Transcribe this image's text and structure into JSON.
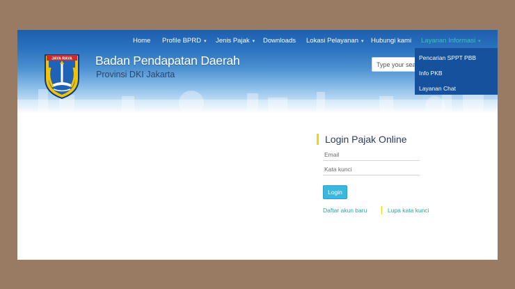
{
  "nav": {
    "items": [
      {
        "label": "Home",
        "dropdown": false
      },
      {
        "label": "Profile BPRD",
        "dropdown": true
      },
      {
        "label": "Jenis Pajak",
        "dropdown": true
      },
      {
        "label": "Downloads",
        "dropdown": false
      },
      {
        "label": "Lokasi Pelayanan",
        "dropdown": true
      },
      {
        "label": "Hubungi kami",
        "dropdown": false
      },
      {
        "label": "Layanan Informasi",
        "dropdown": true,
        "active": true
      }
    ],
    "caret": "▾"
  },
  "logo": {
    "banner_text": "JAYA RAYA"
  },
  "header": {
    "title": "Badan Pendapatan Daerah",
    "subtitle": "Provinsi DKI Jakarta"
  },
  "search": {
    "placeholder": "Type your search"
  },
  "dropdown": {
    "items": [
      "Pencarian SPPT PBB",
      "Info PKB",
      "Layanan Chat"
    ]
  },
  "login": {
    "title": "Login Pajak Online",
    "email_placeholder": "Email",
    "password_placeholder": "Kata kunci",
    "button_label": "Login",
    "register_link": "Daftar akun baru",
    "forgot_link": "Lupa kata kunci"
  },
  "colors": {
    "frame": "#997a62",
    "header_blue": "#1d5fae",
    "dropdown_bg": "#15519c",
    "accent_teal": "#20a99a",
    "accent_yellow": "#f2d600",
    "button_blue": "#3ab8e0"
  }
}
